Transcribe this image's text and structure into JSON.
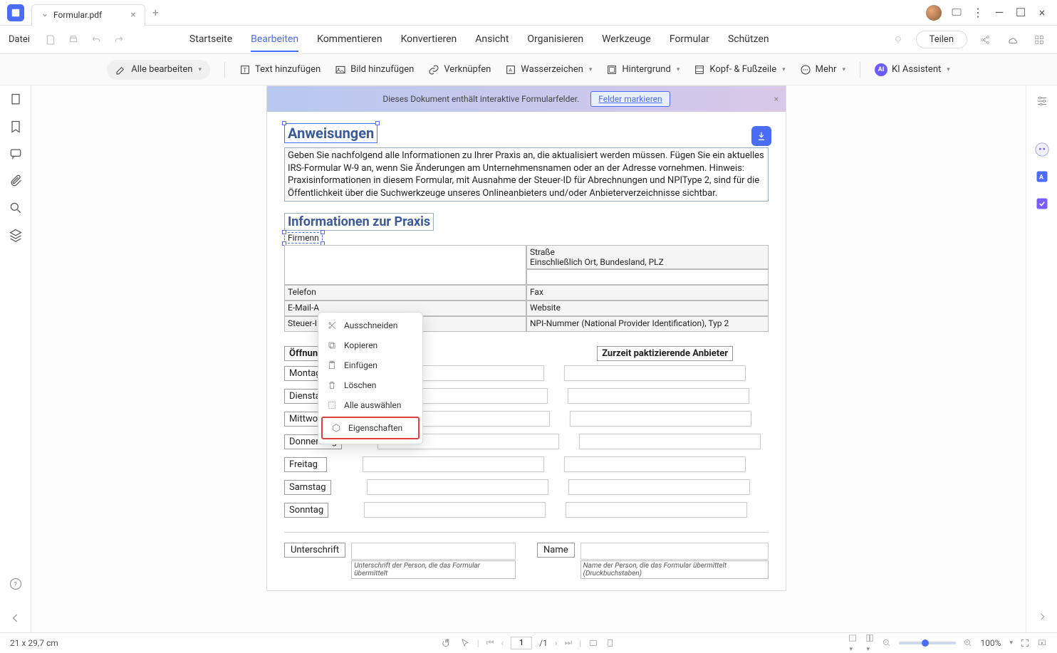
{
  "window": {
    "tab_title": "Formular.pdf",
    "file_menu": "Datei"
  },
  "menu_tabs": [
    "Startseite",
    "Bearbeiten",
    "Kommentieren",
    "Konvertieren",
    "Ansicht",
    "Organisieren",
    "Werkzeuge",
    "Formular",
    "Schützen"
  ],
  "menu_active_index": 1,
  "share_button": "Teilen",
  "toolbar": {
    "edit_all": "Alle bearbeiten",
    "add_text": "Text hinzufügen",
    "add_image": "Bild hinzufügen",
    "link": "Verknüpfen",
    "watermark": "Wasserzeichen",
    "background": "Hintergrund",
    "header_footer": "Kopf- & Fußzeile",
    "more": "Mehr",
    "ai_assistant": "KI Assistent",
    "ai_badge": "AI"
  },
  "banner": {
    "text": "Dieses Dokument enthält interaktive Formularfelder.",
    "button": "Felder markieren"
  },
  "document": {
    "h1": "Anweisungen",
    "para1": "Geben Sie nachfolgend alle Informationen zu Ihrer Praxis an, die aktualisiert werden müssen. Fügen Sie ein aktuelles IRS-Formular W-9 an, wenn Sie Änderungen am Unternehmensnamen oder an der Adresse vornehmen. Hinweis: Praxisinformationen in diesem Formular, mit Ausnahme der Steuer-ID für Abrechnungen und NPIType 2, sind für die Öffentlichkeit über die Suchwerkzeuge unseres Onlineanbieters und/oder Anbieterverzeichnisse sichtbar.",
    "h2": "Informationen zur Praxis",
    "selected_field": "Firmenn",
    "labels": {
      "street": "Straße",
      "street_sub": "Einschließlich Ort, Bundesland, PLZ",
      "phone": "Telefon",
      "fax": "Fax",
      "email": "E-Mail-A",
      "website": "Website",
      "tax": "Steuer-ID",
      "npi": "NPI-Nummer (National Provider Identification), Typ 2",
      "hours_header": "Öffnungszeiten",
      "providers_header": "Zurzeit paktizierende Anbieter",
      "signature": "Unterschrift",
      "signature_sub": "Unterschrift der Person, die das Formular übermittelt",
      "name": "Name",
      "name_sub": "Name der Person, die das Formular übermittelt (Druckbuchstaben)"
    },
    "days": [
      "Montag",
      "Dienstag",
      "Mittwoch",
      "Donnerstag",
      "Freitag",
      "Samstag",
      "Sonntag"
    ]
  },
  "context_menu": {
    "cut": "Ausschneiden",
    "copy": "Kopieren",
    "paste": "Einfügen",
    "delete": "Löschen",
    "select_all": "Alle auswählen",
    "properties": "Eigenschaften"
  },
  "status": {
    "page_size": "21 x 29,7 cm",
    "current_page": "1",
    "total_pages": "/1",
    "zoom": "100%"
  }
}
